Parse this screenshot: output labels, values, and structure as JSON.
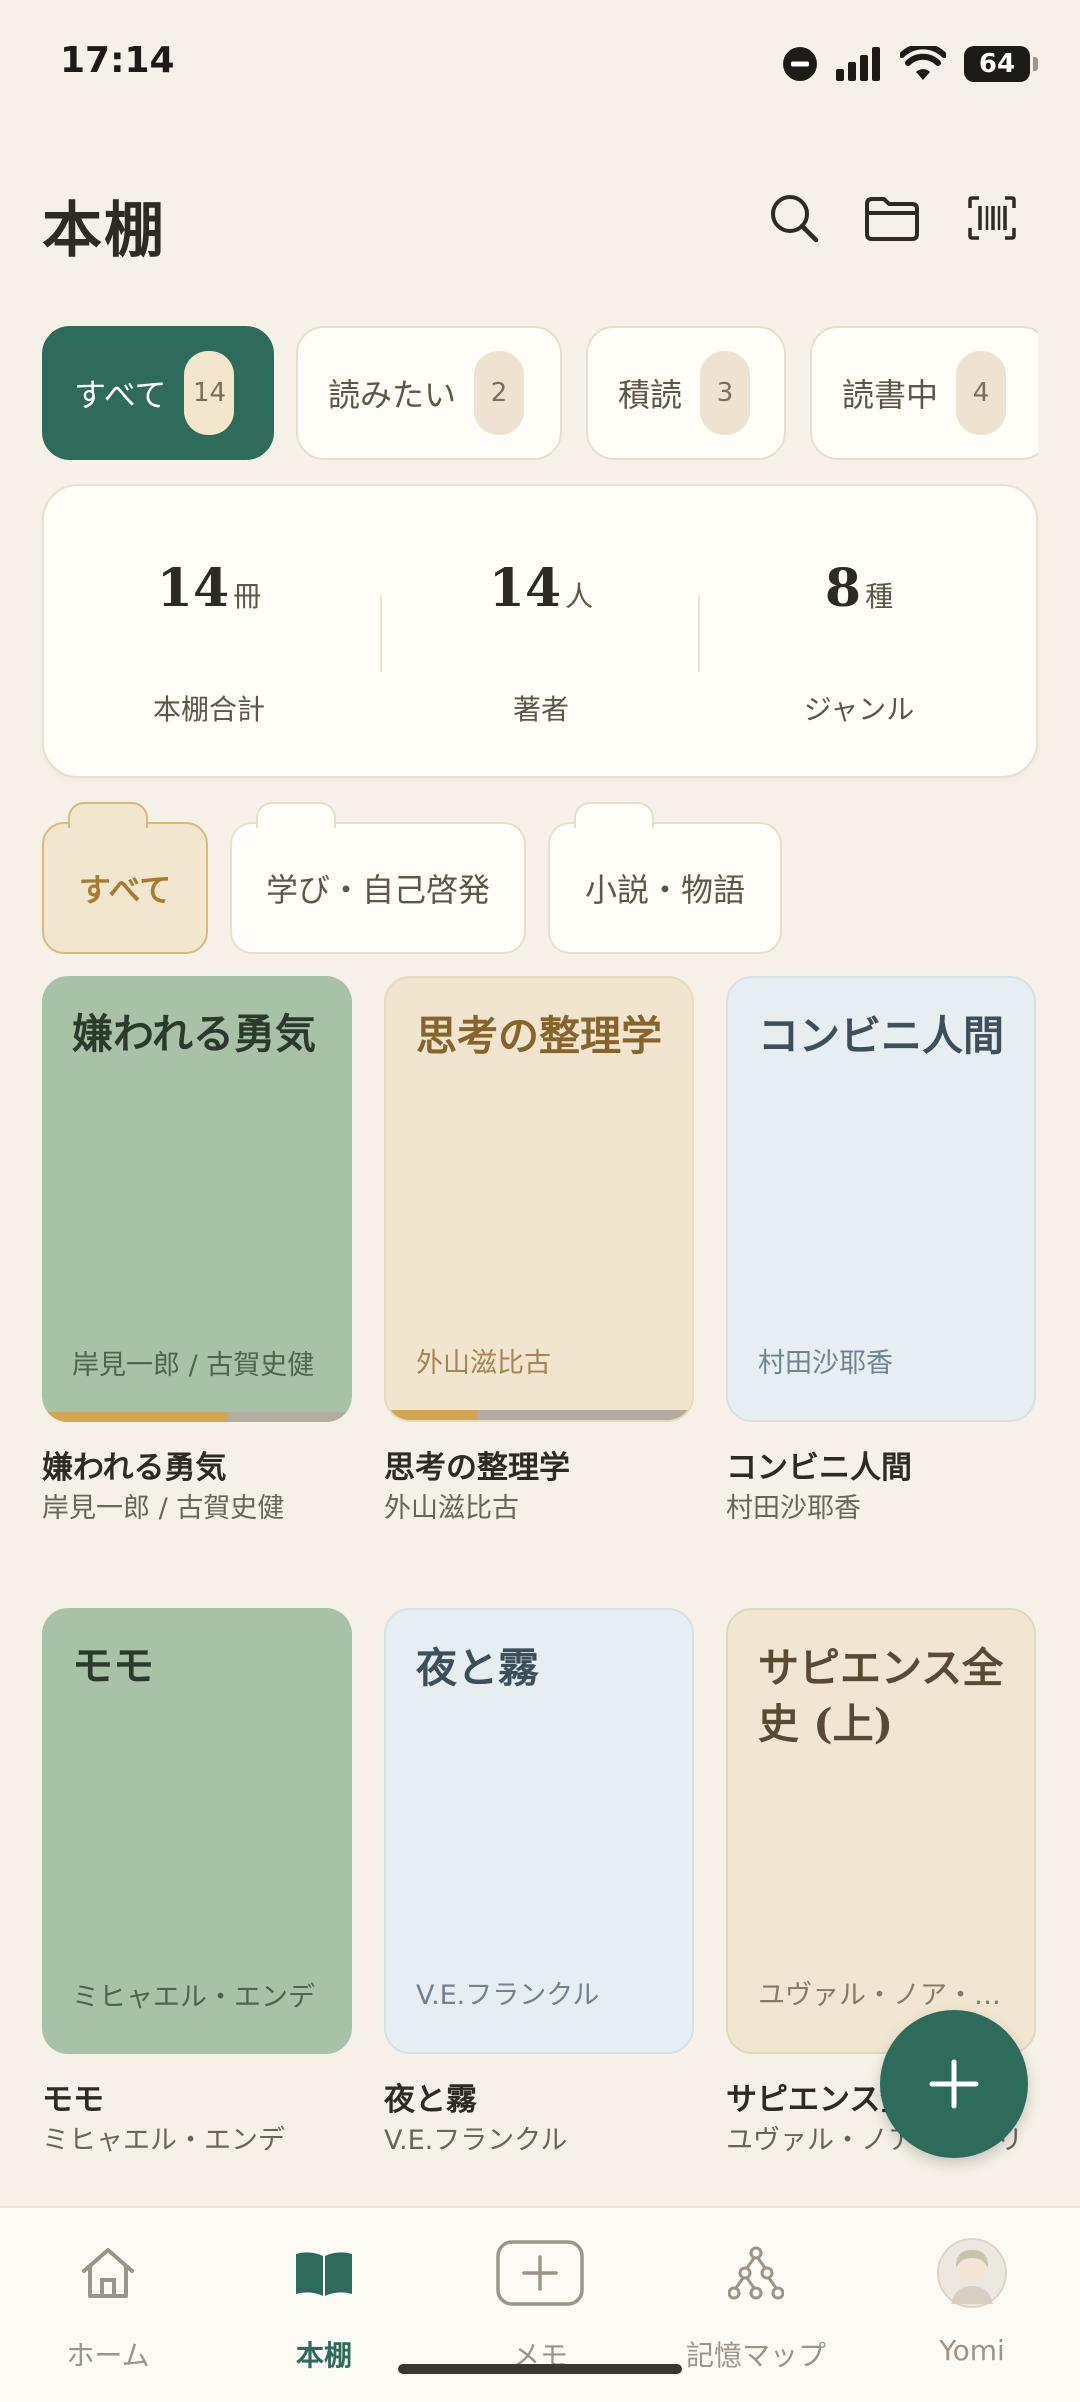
{
  "status_bar": {
    "time": "17:14",
    "battery": "64"
  },
  "header": {
    "title": "本棚",
    "icons": [
      "search-icon",
      "folder-icon",
      "barcode-icon"
    ]
  },
  "filter_tabs": [
    {
      "label": "すべて",
      "count": "14",
      "active": true
    },
    {
      "label": "読みたい",
      "count": "2"
    },
    {
      "label": "積読",
      "count": "3"
    },
    {
      "label": "読書中",
      "count": "4"
    }
  ],
  "stats": [
    {
      "value": "14",
      "unit": "冊",
      "label": "本棚合計"
    },
    {
      "value": "14",
      "unit": "人",
      "label": "著者"
    },
    {
      "value": "8",
      "unit": "種",
      "label": "ジャンル"
    }
  ],
  "folders": [
    {
      "label": "すべて",
      "active": true
    },
    {
      "label": "学び・自己啓発"
    },
    {
      "label": "小説・物語"
    }
  ],
  "books": [
    {
      "cover_title": "嫌われる勇気",
      "cover_author": "岸見一郎 / 古賀史健",
      "title": "嫌われる勇気",
      "author": "岸見一郎 / 古賀史健",
      "color": "green",
      "progress": 0.6
    },
    {
      "cover_title": "思考の整理学",
      "cover_author": "外山滋比古",
      "title": "思考の整理学",
      "author": "外山滋比古",
      "color": "beige",
      "progress": 0.3
    },
    {
      "cover_title": "コンビニ人間",
      "cover_author": "村田沙耶香",
      "title": "コンビニ人間",
      "author": "村田沙耶香",
      "color": "blue"
    },
    {
      "cover_title": "モモ",
      "cover_author": "ミヒャエル・エンデ",
      "title": "モモ",
      "author": "ミヒャエル・エンデ",
      "color": "green"
    },
    {
      "cover_title": "夜と霧",
      "cover_author": "V.E.フランクル",
      "title": "夜と霧",
      "author": "V.E.フランクル",
      "color": "blue"
    },
    {
      "cover_title": "サピエンス全史 (上)",
      "cover_author": "ユヴァル・ノア・ハラリ",
      "title": "サピエンス全史 (上)",
      "author": "ユヴァル・ノア・ハラリ",
      "color": "sand"
    }
  ],
  "fab": {
    "icon": "plus-icon"
  },
  "bottom_nav": [
    {
      "label": "ホーム",
      "icon": "home-icon"
    },
    {
      "label": "本棚",
      "icon": "book-icon",
      "active": true
    },
    {
      "label": "メモ",
      "icon": "add-memo-icon"
    },
    {
      "label": "記憶マップ",
      "icon": "network-icon"
    },
    {
      "label": "Yomi",
      "icon": "avatar"
    }
  ],
  "colors": {
    "accent": "#2e6b5a",
    "background": "#f5f1e8",
    "progress": "#d2a553"
  }
}
